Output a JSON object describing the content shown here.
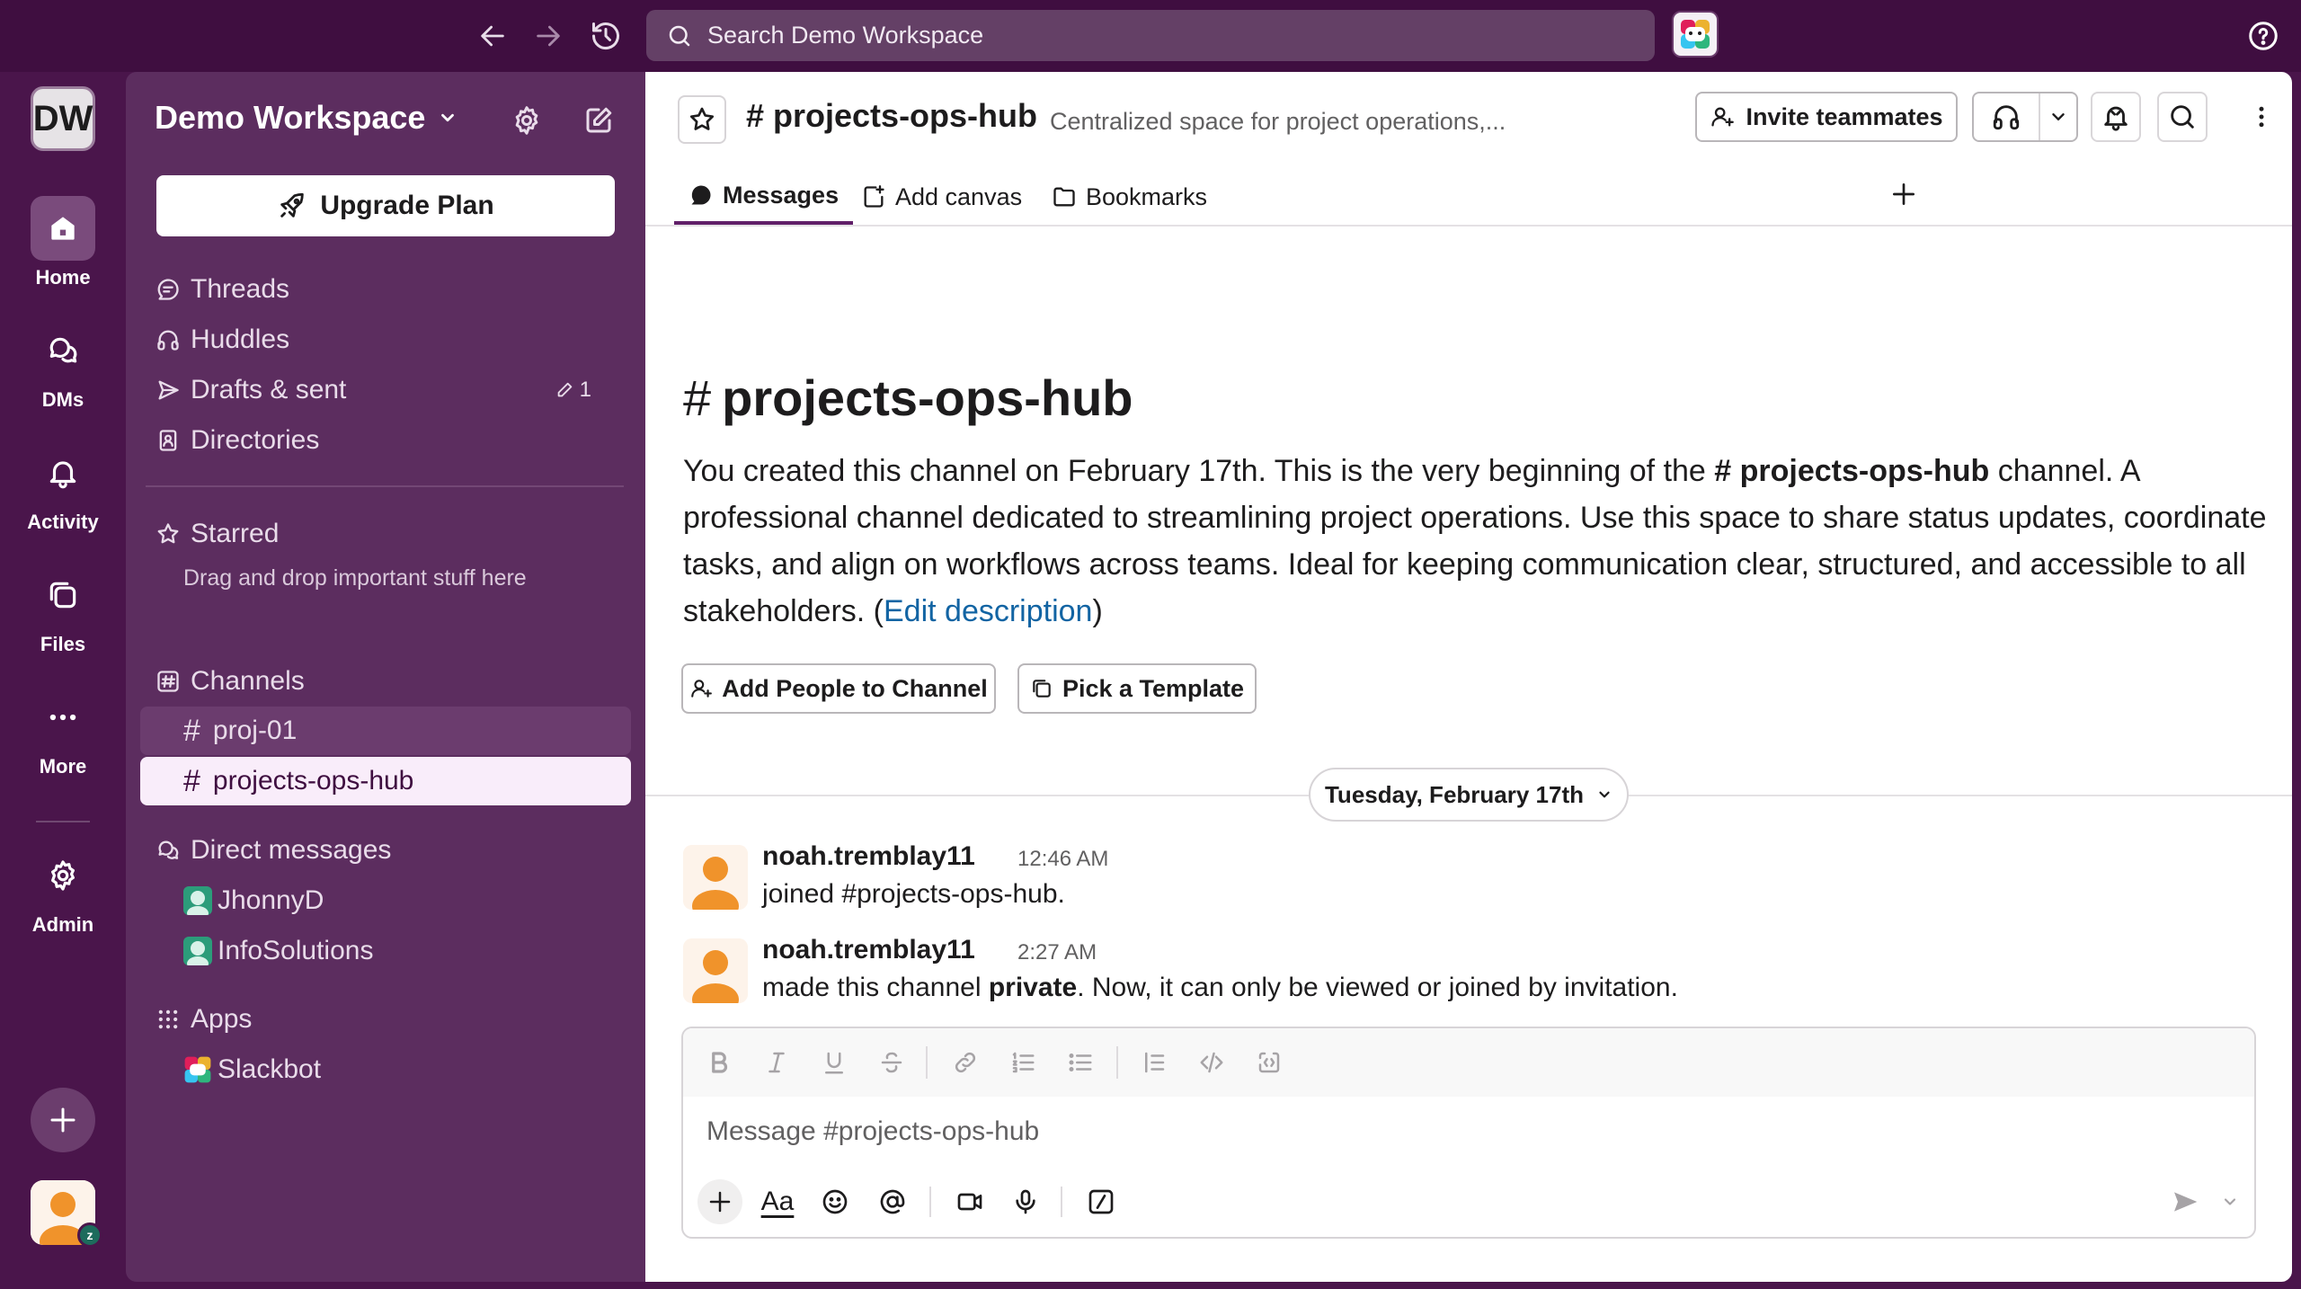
{
  "topbar": {
    "search_placeholder": "Search Demo Workspace"
  },
  "rail": {
    "workspace_initials": "DW",
    "items": [
      {
        "label": "Home",
        "icon": "home-icon",
        "active": true
      },
      {
        "label": "DMs",
        "icon": "dms-icon",
        "active": false
      },
      {
        "label": "Activity",
        "icon": "bell-icon",
        "active": false
      },
      {
        "label": "Files",
        "icon": "files-icon",
        "active": false
      },
      {
        "label": "More",
        "icon": "more-icon",
        "active": false
      },
      {
        "label": "Admin",
        "icon": "gear-icon",
        "active": false
      }
    ],
    "user_status_badge": "z"
  },
  "sidebar": {
    "workspace_name": "Demo Workspace",
    "upgrade_label": "Upgrade Plan",
    "nav": {
      "threads": "Threads",
      "huddles": "Huddles",
      "drafts": "Drafts & sent",
      "drafts_count": "1",
      "directories": "Directories"
    },
    "starred": {
      "title": "Starred",
      "hint": "Drag and drop important stuff here"
    },
    "channels": {
      "title": "Channels",
      "items": [
        {
          "hash": "#",
          "name": "proj-01"
        },
        {
          "hash": "#",
          "name": "projects-ops-hub"
        }
      ]
    },
    "direct_messages": {
      "title": "Direct messages",
      "items": [
        {
          "name": "JhonnyD"
        },
        {
          "name": "InfoSolutions"
        }
      ]
    },
    "apps": {
      "title": "Apps",
      "items": [
        {
          "name": "Slackbot"
        }
      ]
    }
  },
  "channel": {
    "title": "# projects-ops-hub",
    "description": "Centralized space for project operations,...",
    "invite_label": "Invite teammates",
    "tabs": [
      {
        "label": "Messages",
        "icon": "message-icon"
      },
      {
        "label": "Add canvas",
        "icon": "canvas-icon"
      },
      {
        "label": "Bookmarks",
        "icon": "folder-icon"
      }
    ]
  },
  "intro": {
    "hash": "#",
    "title": "projects-ops-hub",
    "text_1": "You created this channel on February 17th. This is the very beginning of the ",
    "channel_ref": "# projects-ops-hub",
    "text_2": " channel. A professional channel dedicated to streamlining project operations. Use this space to share status updates, coordinate tasks, and align on workflows across teams. Ideal for keeping communication clear, structured, and accessible to all stakeholders. (",
    "edit_link": "Edit description",
    "text_3": ")",
    "add_people_label": "Add People to Channel",
    "template_label": "Pick a Template"
  },
  "date_divider": "Tuesday, February 17th",
  "messages": [
    {
      "author": "noah.tremblay11",
      "time": "12:46 AM",
      "text": "joined #projects-ops-hub."
    },
    {
      "author": "noah.tremblay11",
      "time": "2:27 AM",
      "text_1": "made this channel ",
      "text_bold": "private",
      "text_2": ". Now, it can only be viewed or joined by invitation."
    }
  ],
  "composer": {
    "placeholder": "Message #projects-ops-hub",
    "aa_label": "Aa"
  },
  "colors": {
    "aubergine": "#4a154b",
    "sidebar": "#5c2d5f",
    "selected_channel": "#f9edfa",
    "link": "#1264a3",
    "avatar_orange": "#f0932b"
  }
}
